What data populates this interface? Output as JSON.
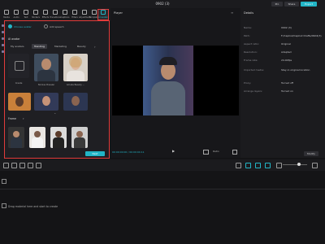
{
  "app": {
    "title": "0902 (3)"
  },
  "header": {
    "pro": "Pro",
    "share": "Share",
    "export": "Export"
  },
  "toolbar": [
    {
      "label": "Media"
    },
    {
      "label": "Audio"
    },
    {
      "label": "Text"
    },
    {
      "label": "Stickers"
    },
    {
      "label": "Effects"
    },
    {
      "label": "Transitions"
    },
    {
      "label": "Captions"
    },
    {
      "label": "Filters"
    },
    {
      "label": "Adjustment"
    },
    {
      "label": "Templates"
    },
    {
      "label": "AI avatars",
      "active": true
    }
  ],
  "avatar_panel": {
    "radio_options": [
      {
        "label": "Choose avatar",
        "selected": true
      },
      {
        "label": "Add speech",
        "selected": false
      }
    ],
    "ai_avatar_title": "AI avatar",
    "tabs": [
      "My avatars",
      "Trending",
      "Marketing",
      "Beauty"
    ],
    "active_tab": "Trending",
    "create_label": "Create",
    "avatars": [
      {
        "name": "Nicolas Pressler"
      },
      {
        "name": "Amelie Beauty ..."
      }
    ],
    "frame_title": "Frame",
    "apply_label": "Next"
  },
  "player": {
    "title": "Player",
    "time": "00:00:00:00 / 00:00:04:11",
    "ratio": "Ratio"
  },
  "details": {
    "title": "Details",
    "rows": [
      {
        "key": "Name:",
        "value": "0902 (3)"
      },
      {
        "key": "Path:",
        "value": "F:/CapCut/CapCut Drafts/0902(3)"
      },
      {
        "key": "Aspect ratio:",
        "value": "Original"
      },
      {
        "key": "Resolution:",
        "value": "Adapted"
      },
      {
        "key": "Frame rate:",
        "value": "24.00fps"
      },
      {
        "key": "Imported media:",
        "value": "Stay in original location"
      },
      {
        "key": "Proxy:",
        "value": "Turned off"
      },
      {
        "key": "Arrange layers:",
        "value": "Turned on"
      }
    ],
    "modify_label": "Modify"
  },
  "timeline": {
    "drop_hint": "Drag material here and start to create"
  }
}
